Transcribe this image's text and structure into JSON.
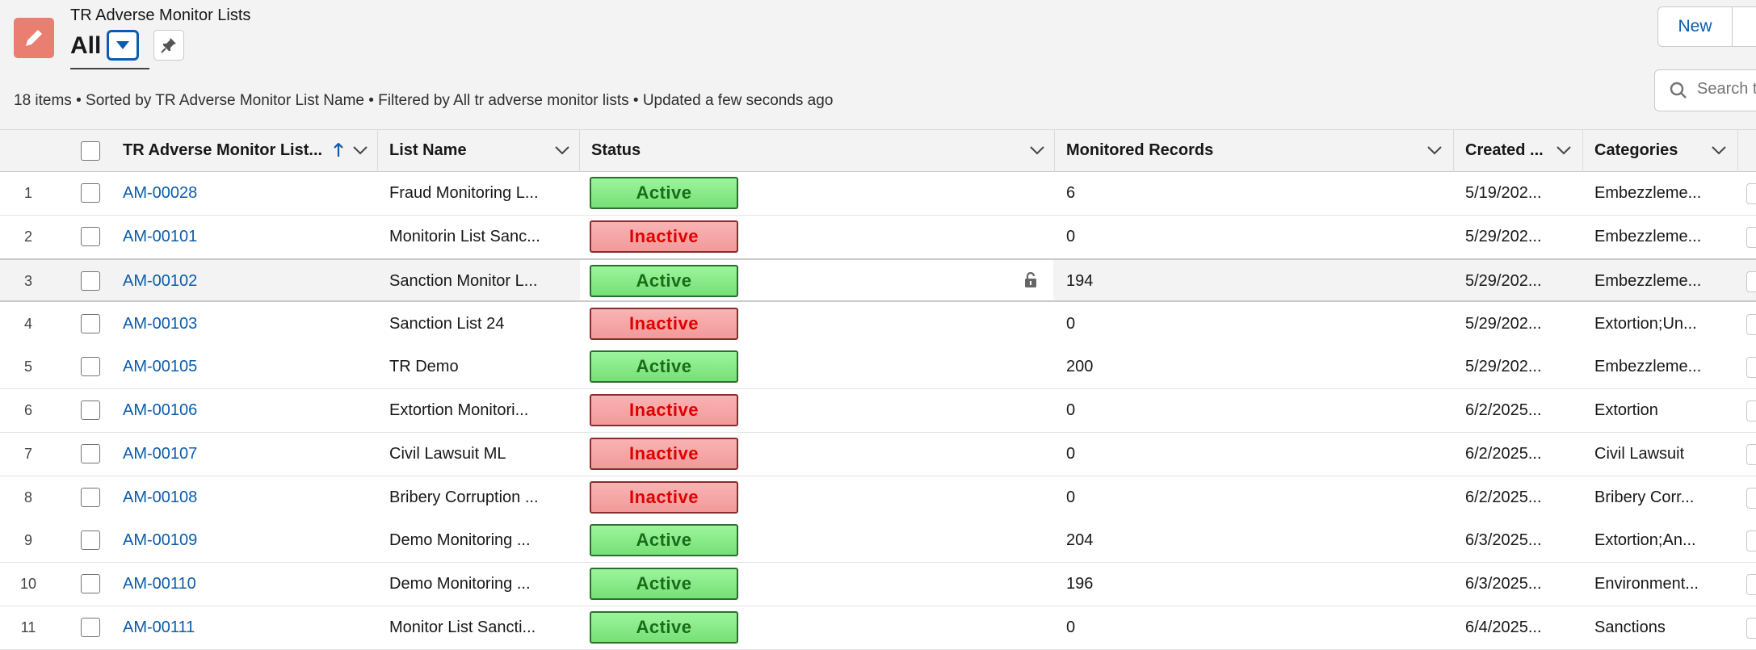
{
  "header": {
    "object_label": "TR Adverse Monitor Lists",
    "view_title": "All",
    "new_label": "New",
    "search_placeholder": "Search this list...",
    "info": "18 items • Sorted by TR Adverse Monitor List Name • Filtered by All tr adverse monitor lists • Updated a few seconds ago"
  },
  "columns": [
    {
      "label": "TR Adverse Monitor List..."
    },
    {
      "label": "List Name"
    },
    {
      "label": "Status"
    },
    {
      "label": "Monitored Records"
    },
    {
      "label": "Created ..."
    },
    {
      "label": "Categories"
    }
  ],
  "rows": [
    {
      "num": "1",
      "id": "AM-00028",
      "name": "Fraud Monitoring L...",
      "status": "Active",
      "records": "6",
      "created": "5/19/202...",
      "categories": "Embezzleme..."
    },
    {
      "num": "2",
      "id": "AM-00101",
      "name": "Monitorin List Sanc...",
      "status": "Inactive",
      "records": "0",
      "created": "5/29/202...",
      "categories": "Embezzleme..."
    },
    {
      "num": "3",
      "id": "AM-00102",
      "name": "Sanction Monitor L...",
      "status": "Active",
      "records": "194",
      "created": "5/29/202...",
      "categories": "Embezzleme..."
    },
    {
      "num": "4",
      "id": "AM-00103",
      "name": "Sanction List 24",
      "status": "Inactive",
      "records": "0",
      "created": "5/29/202...",
      "categories": "Extortion;Un..."
    },
    {
      "num": "5",
      "id": "AM-00105",
      "name": "TR Demo",
      "status": "Active",
      "records": "200",
      "created": "5/29/202...",
      "categories": "Embezzleme..."
    },
    {
      "num": "6",
      "id": "AM-00106",
      "name": "Extortion Monitori...",
      "status": "Inactive",
      "records": "0",
      "created": "6/2/2025...",
      "categories": "Extortion"
    },
    {
      "num": "7",
      "id": "AM-00107",
      "name": "Civil Lawsuit ML",
      "status": "Inactive",
      "records": "0",
      "created": "6/2/2025...",
      "categories": "Civil Lawsuit"
    },
    {
      "num": "8",
      "id": "AM-00108",
      "name": "Bribery Corruption ...",
      "status": "Inactive",
      "records": "0",
      "created": "6/2/2025...",
      "categories": "Bribery Corr..."
    },
    {
      "num": "9",
      "id": "AM-00109",
      "name": "Demo Monitoring ...",
      "status": "Active",
      "records": "204",
      "created": "6/3/2025...",
      "categories": "Extortion;An..."
    },
    {
      "num": "10",
      "id": "AM-00110",
      "name": "Demo Monitoring ...",
      "status": "Active",
      "records": "196",
      "created": "6/3/2025...",
      "categories": "Environment..."
    },
    {
      "num": "11",
      "id": "AM-00111",
      "name": "Monitor List Sancti...",
      "status": "Active",
      "records": "0",
      "created": "6/4/2025...",
      "categories": "Sanctions"
    }
  ],
  "colors": {
    "accent": "#0b5cab",
    "object_icon": "#ea7e70",
    "active_bg": "#8ef08e",
    "inactive_bg": "#f7a8a8",
    "inactive_text": "#e00000"
  },
  "icons": [
    "pencil-icon",
    "chevron-down-icon",
    "pin-icon",
    "search-icon",
    "lock-icon",
    "sort-ascending-icon"
  ]
}
